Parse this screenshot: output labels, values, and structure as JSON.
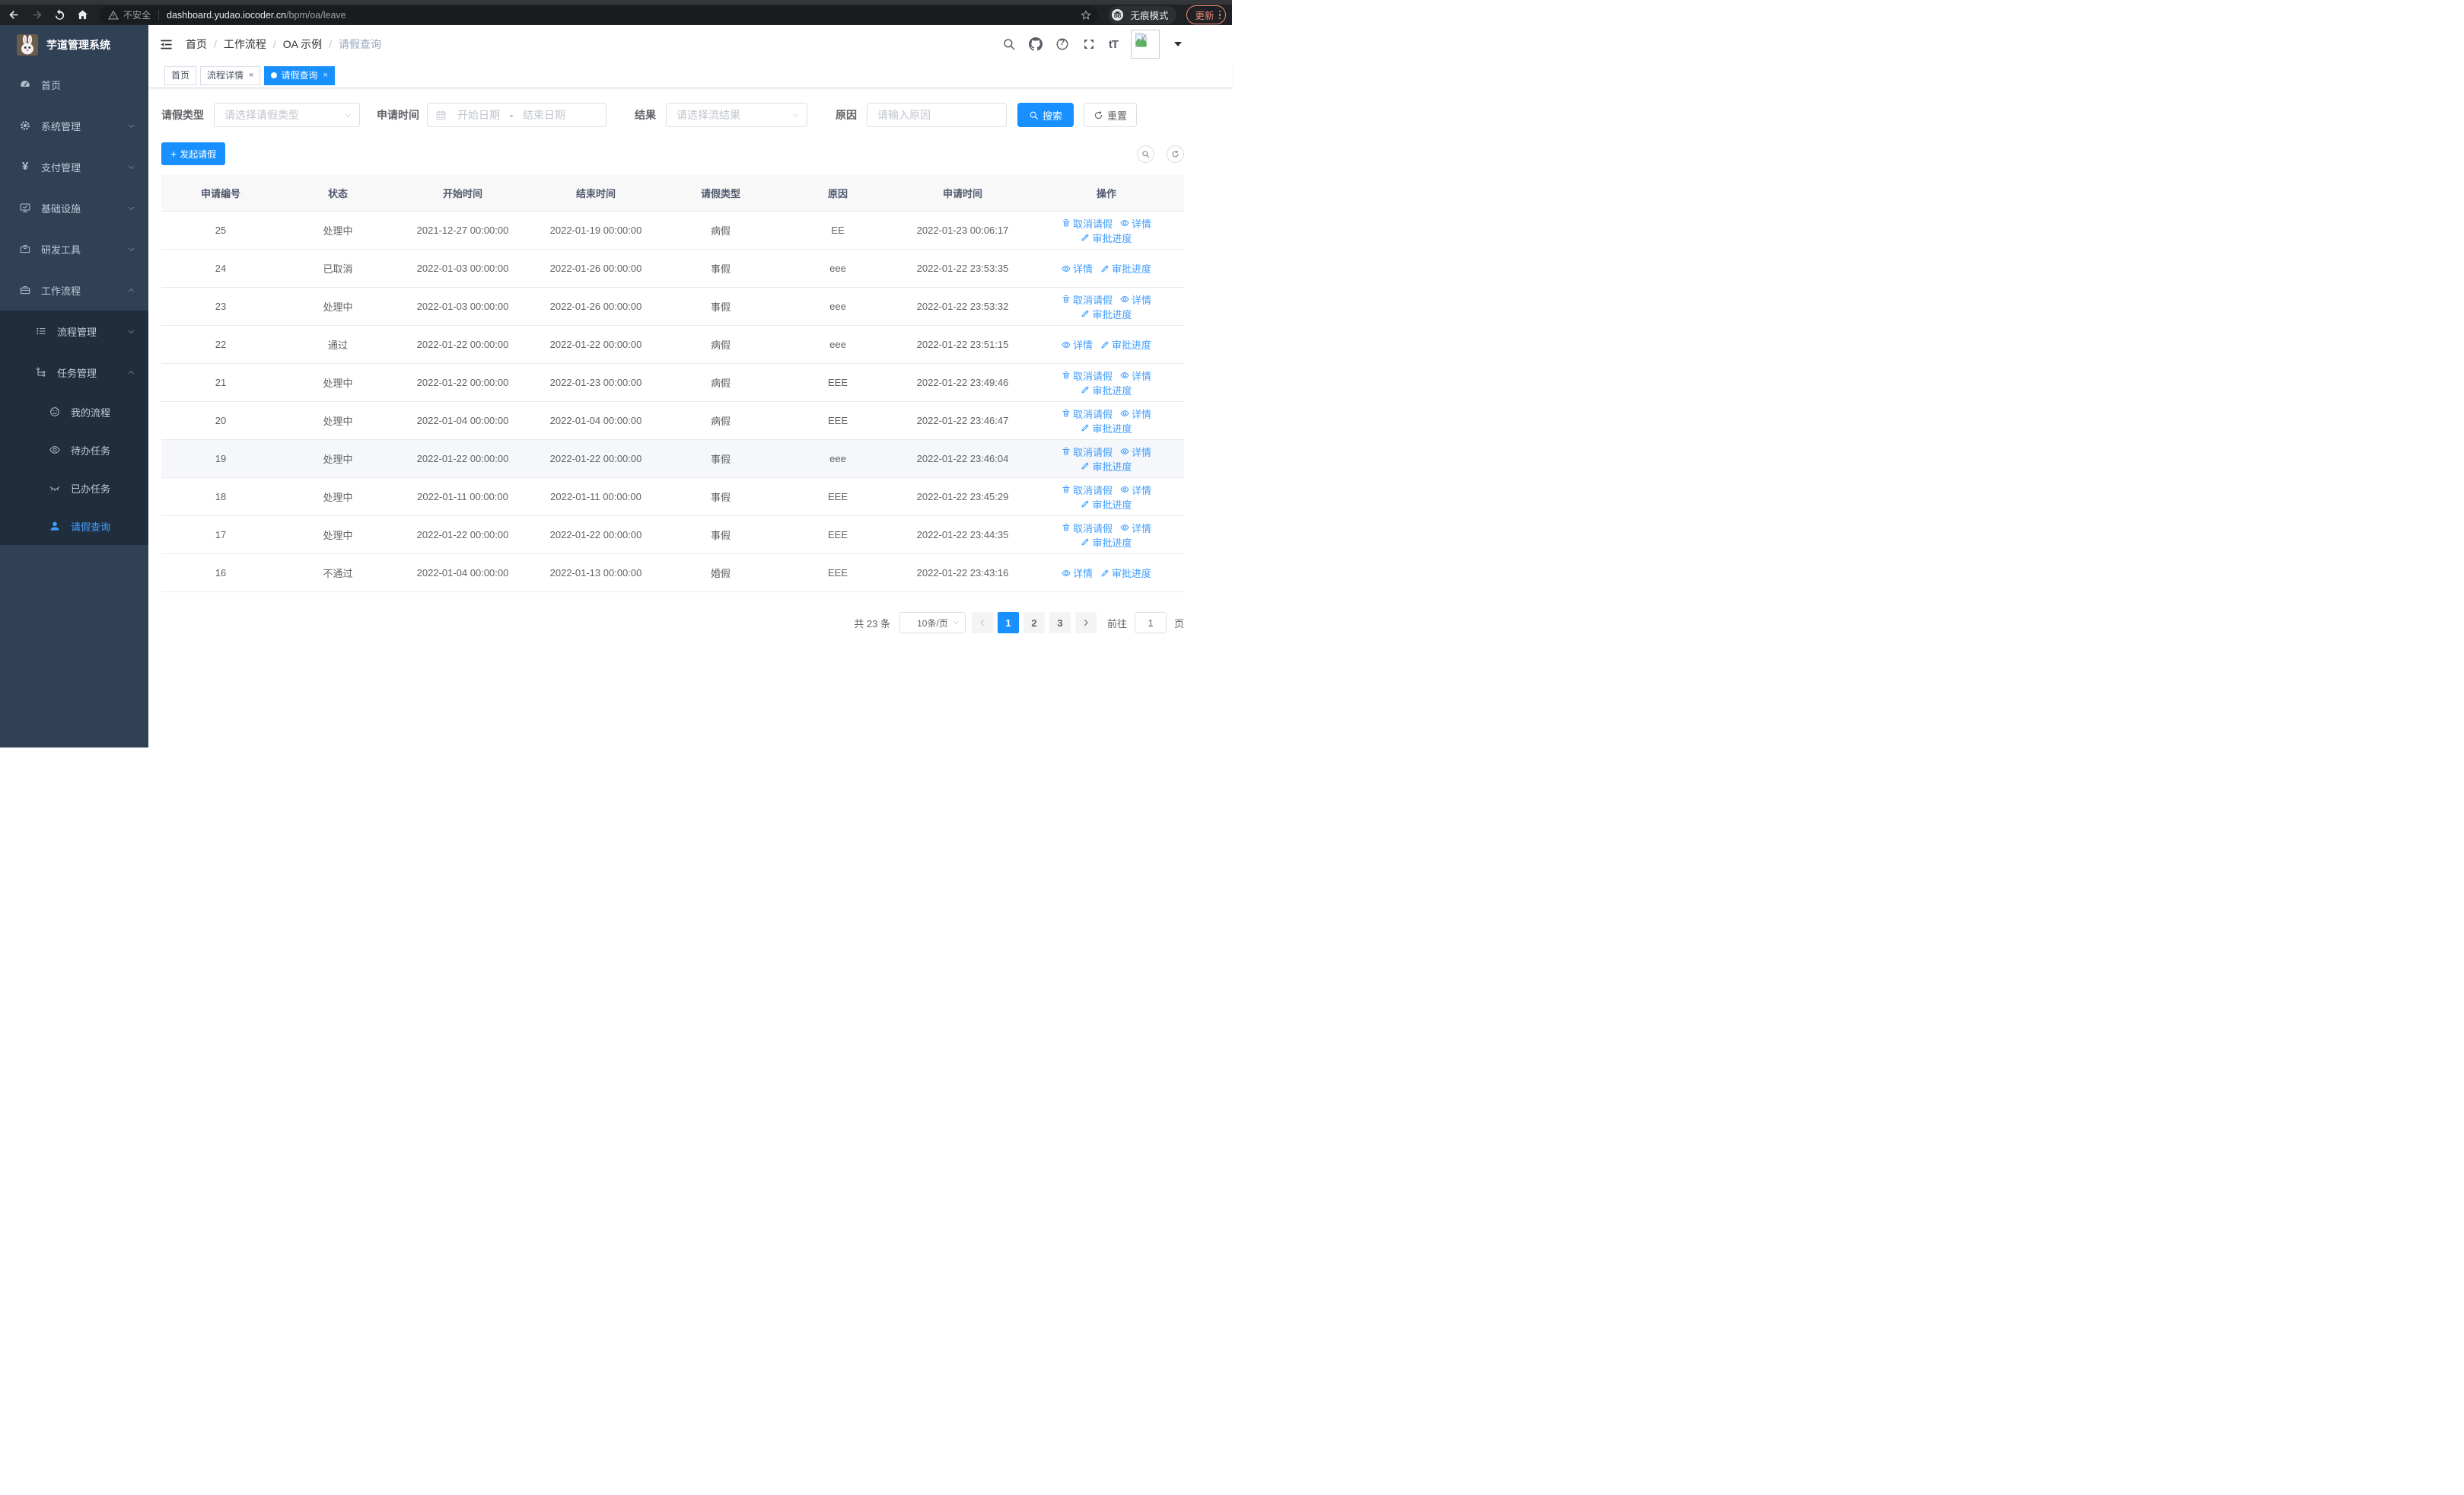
{
  "glyphs": {
    "close": "×",
    "yen": "¥",
    "question": "?",
    "font_size": "tT",
    "plus": "+"
  },
  "browser": {
    "security_label": "不安全",
    "url_domain": "dashboard.yudao.iocoder.cn",
    "url_path": "/bpm/oa/leave",
    "incognito_label": "无痕模式",
    "update_label": "更新"
  },
  "sidebar": {
    "app_title": "芋道管理系统",
    "items": [
      {
        "label": "首页",
        "icon": "dashboard-icon"
      },
      {
        "label": "系统管理",
        "icon": "gear-icon"
      },
      {
        "label": "支付管理",
        "icon": "yen-icon"
      },
      {
        "label": "基础设施",
        "icon": "monitor-icon"
      },
      {
        "label": "研发工具",
        "icon": "toolbox-icon"
      },
      {
        "label": "工作流程",
        "icon": "briefcase-icon"
      },
      {
        "label": "流程管理",
        "icon": "list-icon"
      },
      {
        "label": "任务管理",
        "icon": "tree-icon"
      },
      {
        "label": "我的流程",
        "icon": "face-icon"
      },
      {
        "label": "待办任务",
        "icon": "eye-icon"
      },
      {
        "label": "已办任务",
        "icon": "eye-closed-icon"
      },
      {
        "label": "请假查询",
        "icon": "user-icon",
        "active": true
      }
    ]
  },
  "header": {
    "separator": "/",
    "breadcrumbs": [
      "首页",
      "工作流程",
      "OA 示例",
      "请假查询"
    ]
  },
  "tabs": [
    {
      "label": "首页",
      "closable": false,
      "active": false
    },
    {
      "label": "流程详情",
      "closable": true,
      "active": false
    },
    {
      "label": "请假查询",
      "closable": true,
      "active": true
    }
  ],
  "filters": {
    "leave_type_label": "请假类型",
    "leave_type_placeholder": "请选择请假类型",
    "apply_time_label": "申请时间",
    "start_date_placeholder": "开始日期",
    "date_separator": "-",
    "end_date_placeholder": "结束日期",
    "result_label": "结果",
    "result_placeholder": "请选择流结果",
    "reason_label": "原因",
    "reason_placeholder": "请输入原因",
    "search_label": "搜索",
    "reset_label": "重置"
  },
  "toolbar": {
    "create_label": "发起请假"
  },
  "table": {
    "columns": [
      "申请编号",
      "状态",
      "开始时间",
      "结束时间",
      "请假类型",
      "原因",
      "申请时间",
      "操作"
    ],
    "action_labels": {
      "cancel": "取消请假",
      "detail": "详情",
      "progress": "审批进度"
    },
    "rows": [
      {
        "id": "25",
        "status": "处理中",
        "start": "2021-12-27 00:00:00",
        "end": "2022-01-19 00:00:00",
        "type": "病假",
        "reason": "EE",
        "apply_time": "2022-01-23 00:06:17"
      },
      {
        "id": "24",
        "status": "已取消",
        "start": "2022-01-03 00:00:00",
        "end": "2022-01-26 00:00:00",
        "type": "事假",
        "reason": "eee",
        "apply_time": "2022-01-22 23:53:35"
      },
      {
        "id": "23",
        "status": "处理中",
        "start": "2022-01-03 00:00:00",
        "end": "2022-01-26 00:00:00",
        "type": "事假",
        "reason": "eee",
        "apply_time": "2022-01-22 23:53:32"
      },
      {
        "id": "22",
        "status": "通过",
        "start": "2022-01-22 00:00:00",
        "end": "2022-01-22 00:00:00",
        "type": "病假",
        "reason": "eee",
        "apply_time": "2022-01-22 23:51:15"
      },
      {
        "id": "21",
        "status": "处理中",
        "start": "2022-01-22 00:00:00",
        "end": "2022-01-23 00:00:00",
        "type": "病假",
        "reason": "EEE",
        "apply_time": "2022-01-22 23:49:46"
      },
      {
        "id": "20",
        "status": "处理中",
        "start": "2022-01-04 00:00:00",
        "end": "2022-01-04 00:00:00",
        "type": "病假",
        "reason": "EEE",
        "apply_time": "2022-01-22 23:46:47"
      },
      {
        "id": "19",
        "status": "处理中",
        "start": "2022-01-22 00:00:00",
        "end": "2022-01-22 00:00:00",
        "type": "事假",
        "reason": "eee",
        "apply_time": "2022-01-22 23:46:04",
        "highlight": true
      },
      {
        "id": "18",
        "status": "处理中",
        "start": "2022-01-11 00:00:00",
        "end": "2022-01-11 00:00:00",
        "type": "事假",
        "reason": "EEE",
        "apply_time": "2022-01-22 23:45:29"
      },
      {
        "id": "17",
        "status": "处理中",
        "start": "2022-01-22 00:00:00",
        "end": "2022-01-22 00:00:00",
        "type": "事假",
        "reason": "EEE",
        "apply_time": "2022-01-22 23:44:35"
      },
      {
        "id": "16",
        "status": "不通过",
        "start": "2022-01-04 00:00:00",
        "end": "2022-01-13 00:00:00",
        "type": "婚假",
        "reason": "EEE",
        "apply_time": "2022-01-22 23:43:16"
      }
    ]
  },
  "pagination": {
    "total_label": "共 23 条",
    "page_size": "10条/页",
    "pages": [
      "1",
      "2",
      "3"
    ],
    "active_page": "1",
    "goto_label": "前往",
    "goto_value": "1",
    "page_unit": "页"
  },
  "colors": {
    "primary": "#1890ff",
    "link": "#409eff",
    "sidebar_bg": "#304156",
    "submenu_bg": "#1f2d3d"
  }
}
